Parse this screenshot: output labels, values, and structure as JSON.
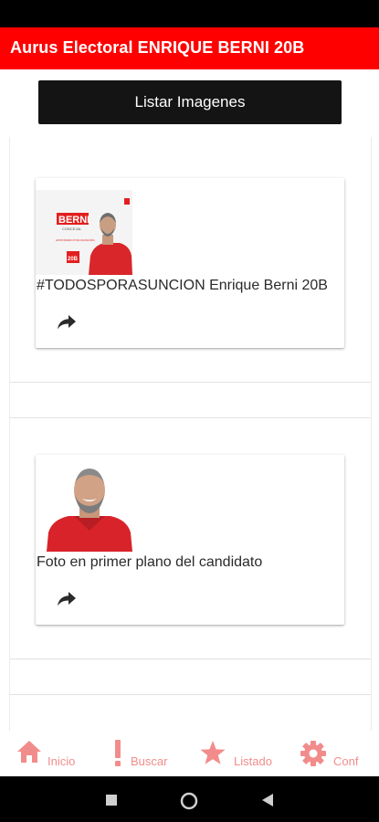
{
  "app": {
    "title": "Aurus Electoral ENRIQUE BERNI 20B",
    "accent_color": "#ff0000"
  },
  "toolbar": {
    "list_button_label": "Listar Imagenes"
  },
  "posts": [
    {
      "caption": "#TODOSPORASUNCION Enrique Berni 20B",
      "image": "campaign-poster",
      "poster": {
        "brand": "BERNI",
        "subtitle": "CONCEJAL",
        "tagline": "APOSTANDO POR ASUNCIÓN",
        "number": "20B"
      },
      "action_icon": "share-icon"
    },
    {
      "caption": "Foto en primer plano del candidato",
      "image": "candidate-portrait",
      "action_icon": "share-icon"
    }
  ],
  "bottom_nav": {
    "items": [
      {
        "label": "Inicio",
        "icon": "home-icon"
      },
      {
        "label": "Buscar",
        "icon": "exclamation-icon"
      },
      {
        "label": "Listado",
        "icon": "star-icon"
      },
      {
        "label": "Conf",
        "icon": "gear-icon"
      }
    ],
    "color": "#f28c8c"
  },
  "system_nav": {
    "buttons": [
      "recents-button",
      "home-button",
      "back-button"
    ]
  }
}
